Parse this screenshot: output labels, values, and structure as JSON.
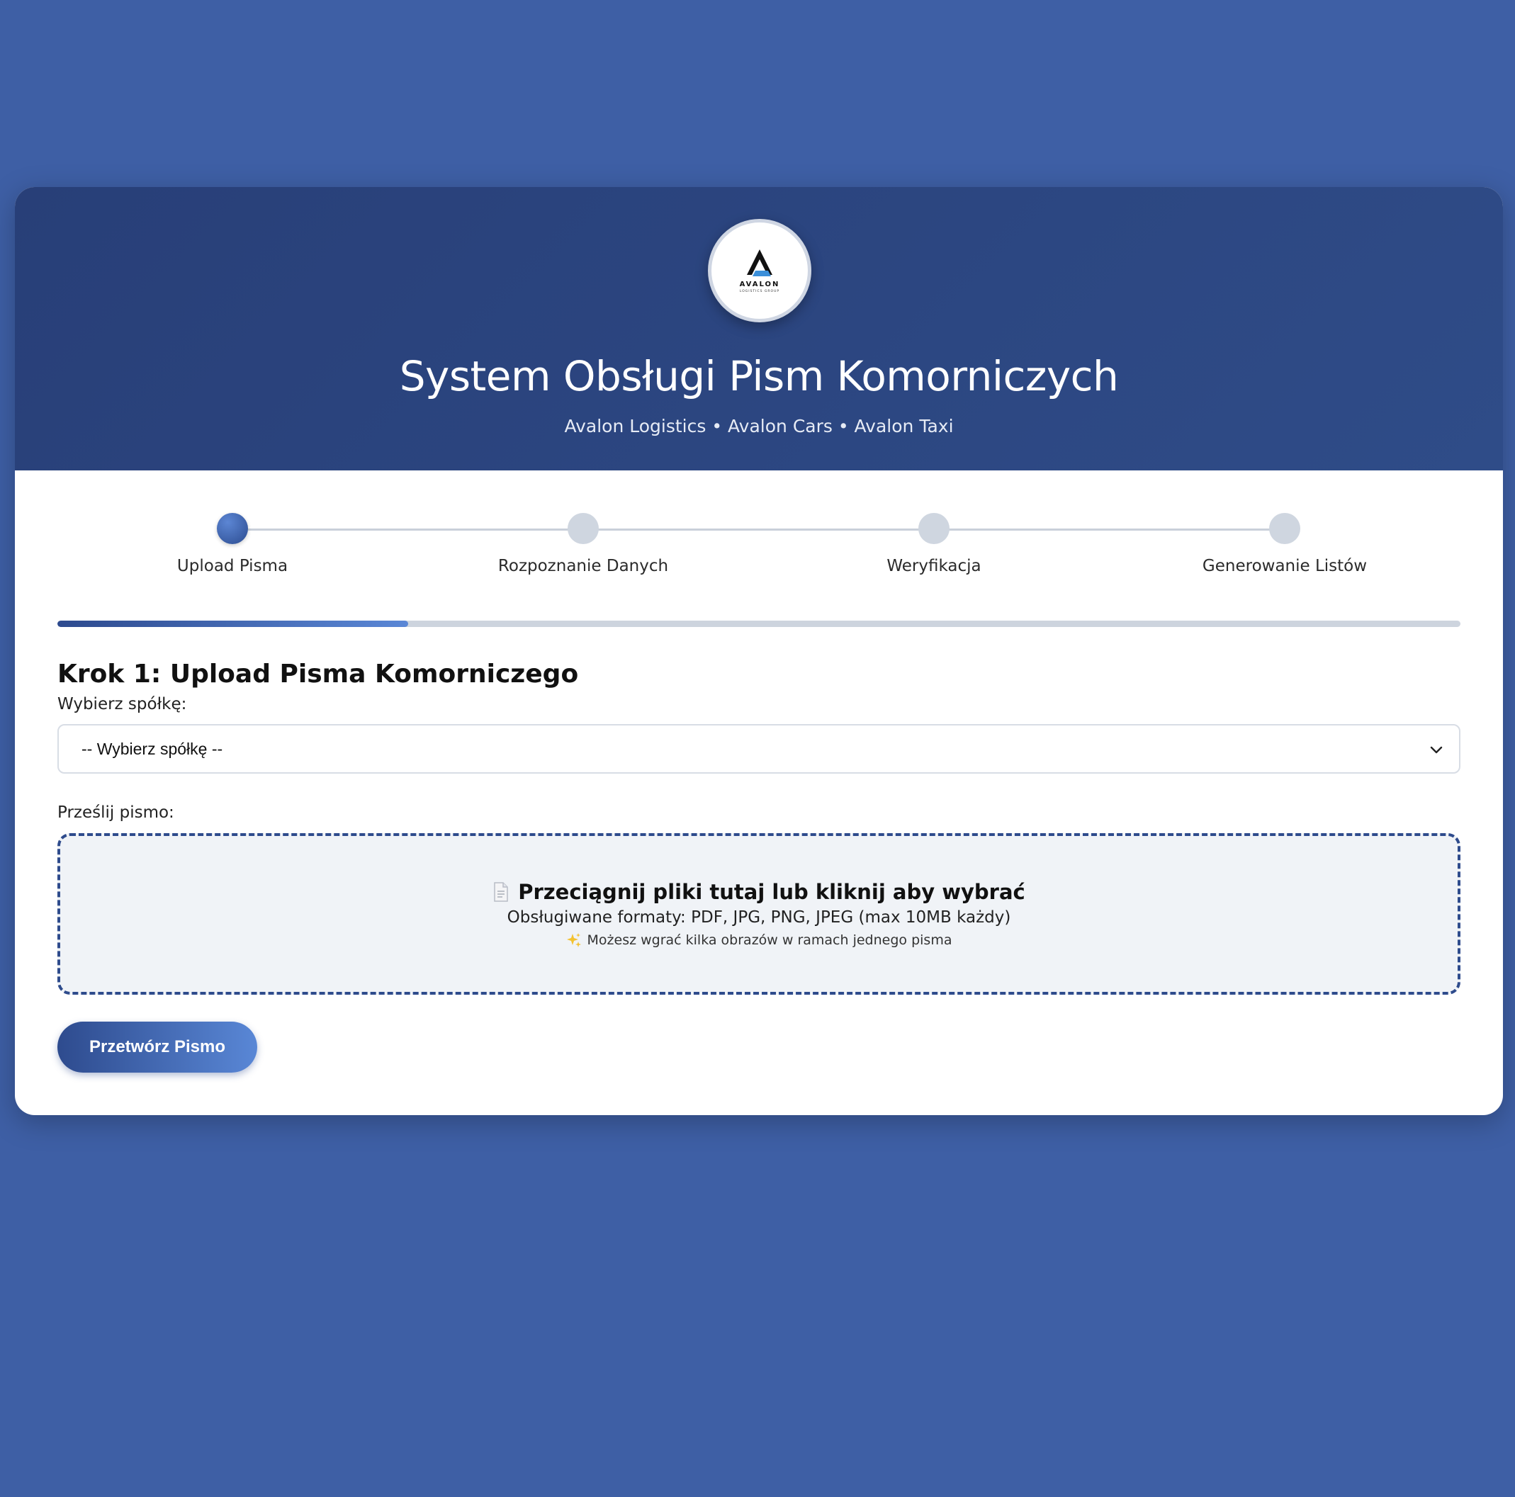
{
  "app": {
    "logo_text": "AVALON",
    "logo_subtext": "LOGISTICS GROUP",
    "title": "System Obsługi Pism Komorniczych",
    "subtitle": "Avalon Logistics • Avalon Cars • Avalon Taxi"
  },
  "wizard": {
    "steps": [
      {
        "label": "Upload Pisma",
        "active": true
      },
      {
        "label": "Rozpoznanie Danych",
        "active": false
      },
      {
        "label": "Weryfikacja",
        "active": false
      },
      {
        "label": "Generowanie Listów",
        "active": false
      }
    ],
    "progress_percent": 25
  },
  "form": {
    "step_title": "Krok 1: Upload Pisma Komorniczego",
    "company_label": "Wybierz spółkę:",
    "company_selected": "-- Wybierz spółkę --",
    "upload_label": "Prześlij pismo:",
    "dropzone": {
      "main_text": "Przeciągnij pliki tutaj lub kliknij aby wybrać",
      "formats_text": "Obsługiwane formaty: PDF, JPG, PNG, JPEG (max 10MB każdy)",
      "hint_text": "Możesz wgrać kilka obrazów w ramach jednego pisma",
      "main_icon": "document-icon",
      "hint_icon": "sparkles-icon"
    },
    "submit_label": "Przetwórz Pismo"
  },
  "colors": {
    "background": "#3e5fa5",
    "header": "#2c4680",
    "accent": "#2e4b8e",
    "accent_light": "#5987d6"
  }
}
